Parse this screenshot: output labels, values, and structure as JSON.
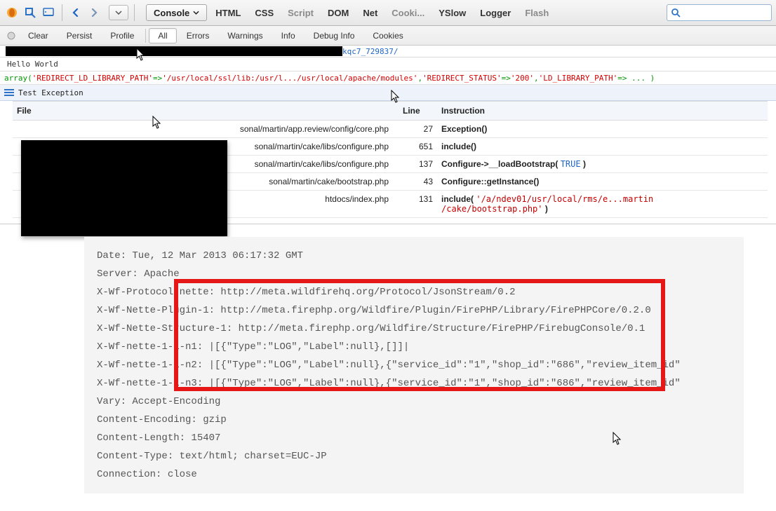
{
  "toolbar": {
    "console_label": "Console",
    "tabs": [
      "HTML",
      "CSS",
      "Script",
      "DOM",
      "Net",
      "Cooki...",
      "YSlow",
      "Logger",
      "Flash"
    ],
    "tabs_enabled": [
      true,
      true,
      false,
      true,
      true,
      false,
      true,
      true,
      false
    ]
  },
  "subbar": {
    "buttons": [
      "Clear",
      "Persist",
      "Profile",
      "All",
      "Errors",
      "Warnings",
      "Info",
      "Debug Info",
      "Cookies"
    ],
    "active": "All"
  },
  "url_tail": "kqc7_729837/",
  "hello": "Hello World",
  "array_parts": {
    "prefix": "array(",
    "k1": "'REDIRECT_LD_LIBRARY_PATH'",
    "a1": "=>",
    "v1": "'/usr/local/ssl/lib:/usr/l.../usr/local/apache/modules'",
    "sep1": ", ",
    "k2": "'REDIRECT_STATUS'",
    "a2": "=>",
    "v2": "'200'",
    "sep2": ", ",
    "k3": "'LD_LIBRARY_PATH'",
    "a3": "=> ... )"
  },
  "exception_label": "Test Exception",
  "trace": {
    "headers": {
      "file": "File",
      "line": "Line",
      "instr": "Instruction"
    },
    "rows": [
      {
        "file": "sonal/martin/app.review/config/core.php",
        "line": "27",
        "instr_html": "<span class='inst-bold'>Exception()</span>"
      },
      {
        "file": "sonal/martin/cake/libs/configure.php",
        "line": "651",
        "instr_html": "<span class='inst-bold'>include()</span>"
      },
      {
        "file": "sonal/martin/cake/libs/configure.php",
        "line": "137",
        "instr_html": "<span class='inst-bold'>Configure-&gt;__loadBootstrap(</span> <span class='inst-blue'>TRUE</span> <span class='inst-bold'>)</span>"
      },
      {
        "file": "sonal/martin/cake/bootstrap.php",
        "line": "43",
        "instr_html": "<span class='inst-bold'>Configure::getInstance()</span>"
      },
      {
        "file": "htdocs/index.php",
        "line": "131",
        "instr_html": "<span class='inst-bold'>include(</span> <span class='inst-red'>'/a/ndev01/usr/local/rms/e...martin<br>/cake/bootstrap.php'</span> <span class='inst-bold'>)</span>"
      }
    ]
  },
  "headers": [
    "Date: Tue, 12 Mar 2013 06:17:32 GMT",
    "Server: Apache",
    "X-Wf-Protocol-nette: http://meta.wildfirehq.org/Protocol/JsonStream/0.2",
    "X-Wf-Nette-Plugin-1: http://meta.firephp.org/Wildfire/Plugin/FirePHP/Library/FirePHPCore/0.2.0",
    "X-Wf-Nette-Structure-1: http://meta.firephp.org/Wildfire/Structure/FirePHP/FirebugConsole/0.1",
    "X-Wf-nette-1-1-n1: |[{\"Type\":\"LOG\",\"Label\":null},[]]|",
    "X-Wf-nette-1-1-n2: |[{\"Type\":\"LOG\",\"Label\":null},{\"service_id\":\"1\",\"shop_id\":\"686\",\"review_item_id\"",
    "X-Wf-nette-1-1-n3: |[{\"Type\":\"LOG\",\"Label\":null},{\"service_id\":\"1\",\"shop_id\":\"686\",\"review_item_id\"",
    "Vary: Accept-Encoding",
    "Content-Encoding: gzip",
    "Content-Length: 15407",
    "Content-Type: text/html; charset=EUC-JP",
    "Connection: close"
  ]
}
